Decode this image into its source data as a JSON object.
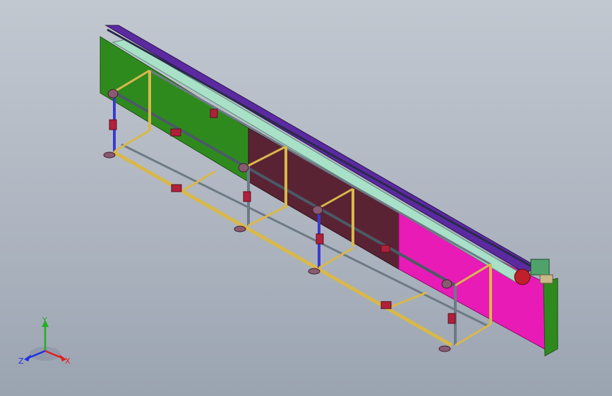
{
  "viewport": {
    "background_top": "#c2c8d0",
    "background_bottom": "#9aa3b0"
  },
  "model": {
    "colors": {
      "green_panel": "#2f8a1e",
      "maroon_panel": "#5a2334",
      "magenta_panel": "#e81bb6",
      "conveyor_top_purple": "#5b2aa0",
      "conveyor_rail_mint": "#a8e0c8",
      "frame_yellow": "#d9b84a",
      "frame_steel": "#6d7a86",
      "frame_blue": "#3a3ad0",
      "bracket_red": "#b0203a",
      "motor_green": "#4fa36a",
      "motor_red": "#c0202a"
    }
  },
  "triad": {
    "x_label": "X",
    "y_label": "Y",
    "z_label": "Z",
    "x_color": "#e02020",
    "y_color": "#20b020",
    "z_color": "#2030e0"
  }
}
